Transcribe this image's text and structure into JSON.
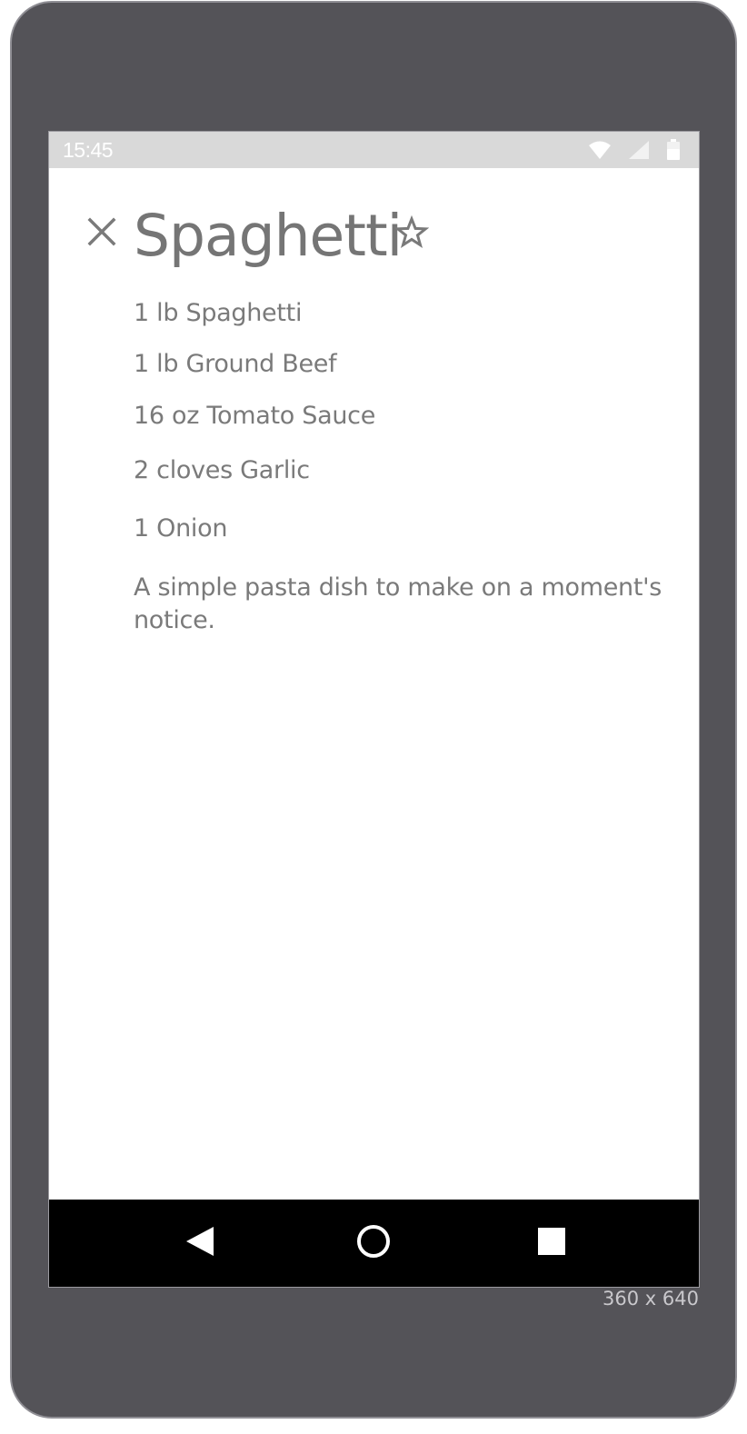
{
  "status_bar": {
    "time": "15:45",
    "icons": [
      "wifi-icon",
      "signal-icon",
      "battery-icon"
    ]
  },
  "recipe": {
    "title": "Spaghetti",
    "ingredients": [
      "1 lb Spaghetti",
      "1 lb Ground Beef",
      "16 oz Tomato Sauce",
      "2 cloves Garlic",
      "1 Onion"
    ],
    "description": "A simple pasta dish to make on a moment's notice."
  },
  "actions": {
    "close_icon": "close-icon",
    "favorite_icon": "star-outline-icon"
  },
  "nav_bar": {
    "icons": [
      "back-icon",
      "home-icon",
      "recents-icon"
    ]
  },
  "device": {
    "resolution": "360 x 640"
  },
  "colors": {
    "frame": "#545358",
    "status_bar": "#d9d9d9",
    "text": "#757575",
    "nav_bar": "#000000"
  }
}
